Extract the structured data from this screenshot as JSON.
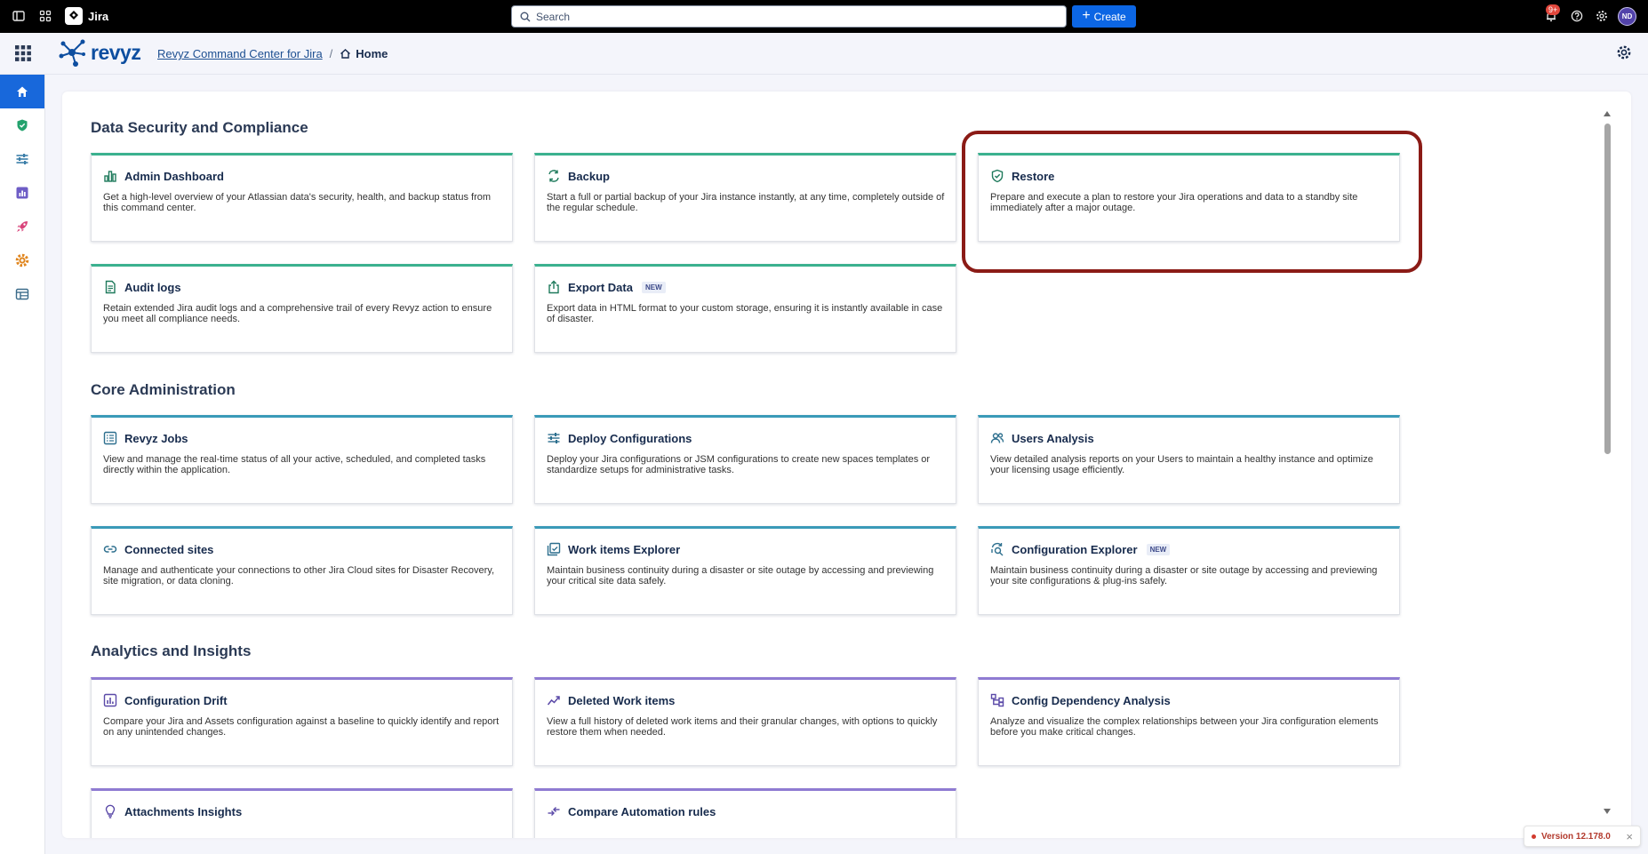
{
  "topbar": {
    "app_name": "Jira",
    "search_placeholder": "Search",
    "create_label": "Create",
    "notifications_badge": "9+",
    "avatar_initials": "ND"
  },
  "header": {
    "brand": "revyz",
    "breadcrumb_app": "Revyz Command Center for Jira",
    "breadcrumb_sep": "/",
    "breadcrumb_current": "Home"
  },
  "sections": [
    {
      "title": "Data Security and Compliance",
      "cards": [
        {
          "title": "Admin Dashboard",
          "desc": "Get a high-level overview of your Atlassian data's security, health, and backup status from this command center.",
          "icon": "bar-chart-icon"
        },
        {
          "title": "Backup",
          "desc": "Start a full or partial backup of your Jira instance instantly, at any time, completely outside of the regular schedule.",
          "icon": "backup-icon"
        },
        {
          "title": "Restore",
          "desc": "Prepare and execute a plan to restore your Jira operations and data to a standby site immediately after a major outage.",
          "icon": "shield-check-icon"
        },
        {
          "title": "Audit logs",
          "desc": "Retain extended Jira audit logs and a comprehensive trail of every Revyz action to ensure you meet all compliance needs.",
          "icon": "document-icon"
        },
        {
          "title": "Export Data",
          "badge": "NEW",
          "desc": "Export data in HTML format to your custom storage, ensuring it is instantly available in case of disaster.",
          "icon": "export-icon"
        }
      ]
    },
    {
      "title": "Core Administration",
      "cards": [
        {
          "title": "Revyz Jobs",
          "desc": "View and manage the real-time status of all your active, scheduled, and completed tasks directly within the application.",
          "icon": "list-icon"
        },
        {
          "title": "Deploy Configurations",
          "desc": "Deploy your Jira configurations or JSM configurations to create new spaces templates or standardize setups for administrative tasks.",
          "icon": "sliders-icon"
        },
        {
          "title": "Users Analysis",
          "desc": "View detailed analysis reports on your Users to maintain a healthy instance and optimize your licensing usage efficiently.",
          "icon": "users-icon"
        },
        {
          "title": "Connected sites",
          "desc": "Manage and authenticate your connections to other Jira Cloud sites for Disaster Recovery, site migration, or data cloning.",
          "icon": "link-icon"
        },
        {
          "title": "Work items Explorer",
          "desc": "Maintain business continuity during a disaster or site outage by accessing and previewing your critical site data safely.",
          "icon": "explorer-icon"
        },
        {
          "title": "Configuration Explorer",
          "badge": "NEW",
          "desc": "Maintain business continuity during a disaster or site outage by accessing and previewing your site configurations & plug-ins safely.",
          "icon": "config-explorer-icon"
        }
      ]
    },
    {
      "title": "Analytics and Insights",
      "cards": [
        {
          "title": "Configuration Drift",
          "desc": "Compare your Jira and Assets configuration against a baseline to quickly identify and report on any unintended changes.",
          "icon": "drift-chart-icon"
        },
        {
          "title": "Deleted Work items",
          "desc": "View a full history of deleted work items and their granular changes, with options to quickly restore them when needed.",
          "icon": "trend-icon"
        },
        {
          "title": "Config Dependency Analysis",
          "desc": "Analyze and visualize the complex relationships between your Jira configuration elements before you make critical changes.",
          "icon": "hierarchy-icon"
        },
        {
          "title": "Attachments Insights",
          "desc": "",
          "icon": "lightbulb-icon"
        },
        {
          "title": "Compare Automation rules",
          "desc": "",
          "icon": "compare-icon"
        }
      ]
    }
  ],
  "version": "Version 12.178.0",
  "version_close": "×"
}
